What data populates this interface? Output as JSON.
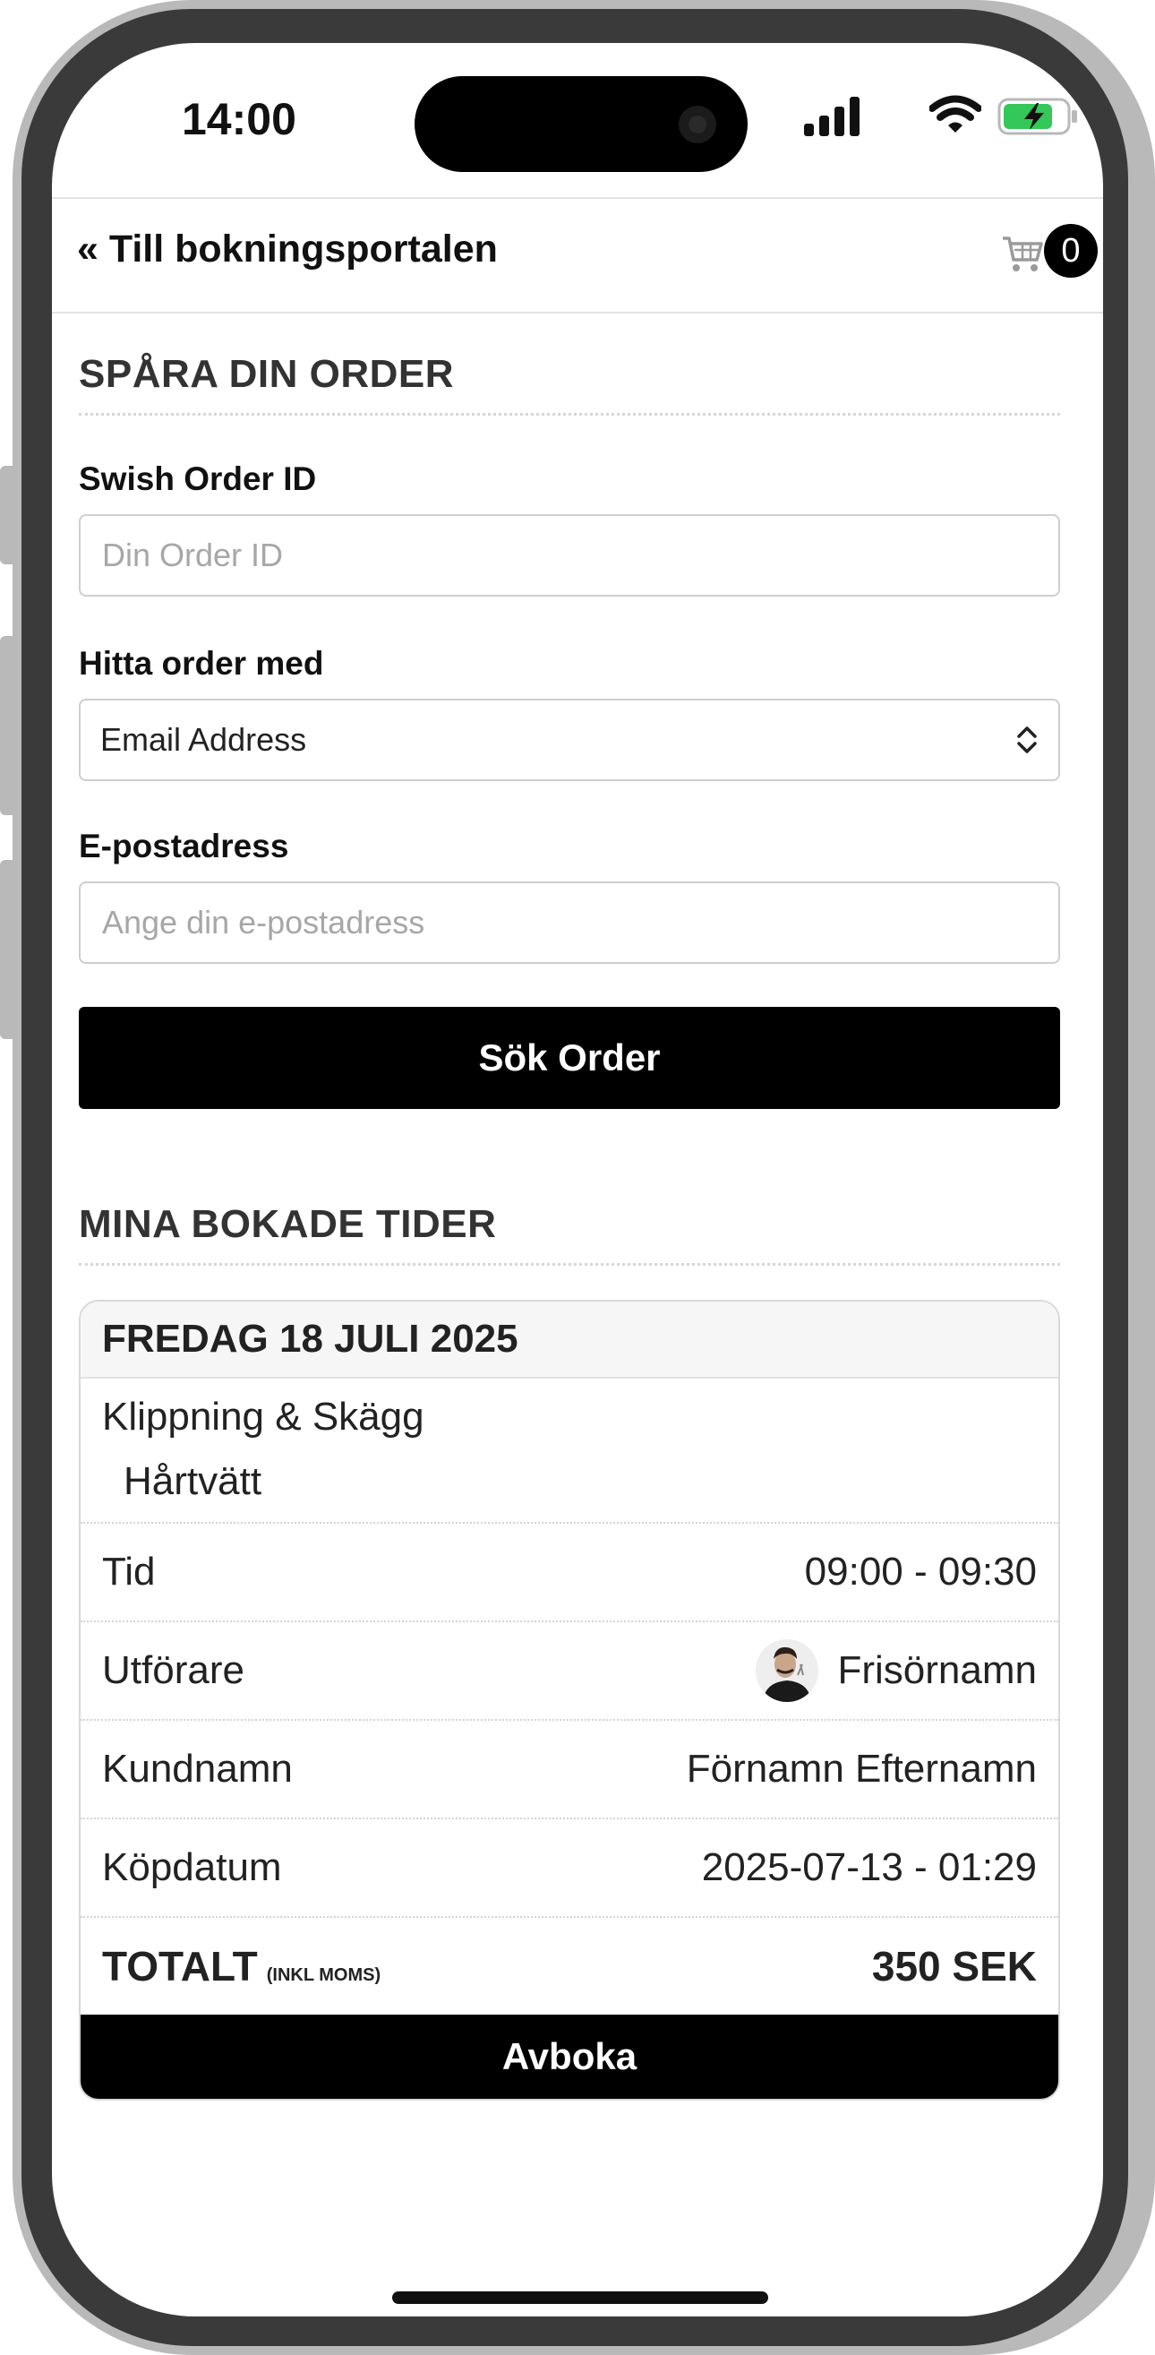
{
  "status_bar": {
    "time": "14:00",
    "icons": [
      "signal-icon",
      "wifi-icon",
      "battery-charging-icon"
    ]
  },
  "nav": {
    "back_label": "« Till bokningsportalen",
    "cart_count": "0",
    "cart_icon": "cart-icon"
  },
  "track_order": {
    "title": "SPÅRA DIN ORDER",
    "order_id_label": "Swish Order ID",
    "order_id_value": "",
    "order_id_placeholder": "Din Order ID",
    "find_by_label": "Hitta order med",
    "find_by_selected": "Email Address",
    "email_label": "E-postadress",
    "email_value": "",
    "email_placeholder": "Ange din e-postadress",
    "search_button": "Sök Order"
  },
  "bookings": {
    "title": "MINA BOKADE TIDER",
    "card": {
      "date": "FREDAG 18 JULI 2025",
      "service_main": "Klippning & Skägg",
      "service_addon": "Hårtvätt",
      "rows": [
        {
          "label": "Tid",
          "value": "09:00 - 09:30"
        },
        {
          "label": "Utförare",
          "value": "Frisörnamn"
        },
        {
          "label": "Kundnamn",
          "value": "Förnamn Efternamn"
        },
        {
          "label": "Köpdatum",
          "value": "2025-07-13 - 01:29"
        }
      ],
      "total_label": "TOTALT",
      "total_sublabel": "(INKL MOMS)",
      "total_value": "350 SEK",
      "cancel_button": "Avboka"
    }
  },
  "colors": {
    "primary_button": "#000000",
    "battery": "#34c759",
    "text": "#222222"
  }
}
